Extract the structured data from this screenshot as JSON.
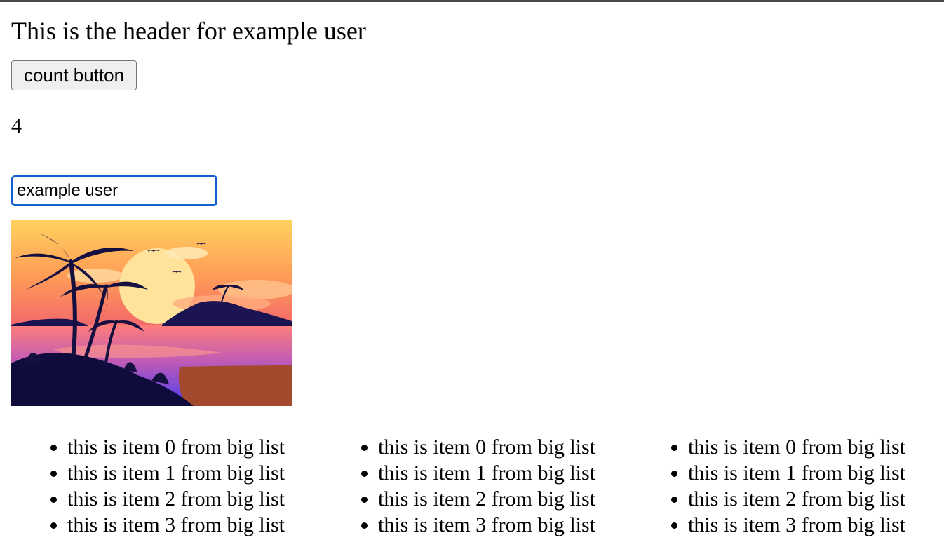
{
  "header": {
    "title": "This is the header for example user"
  },
  "counter": {
    "button_label": "count button",
    "value": "4"
  },
  "user_field": {
    "value": "example user"
  },
  "image": {
    "subject": "tropical sunset with palm tree silhouettes, island and sea"
  },
  "big_list": {
    "columns": [
      {
        "items": [
          "this is item 0 from big list",
          "this is item 1 from big list",
          "this is item 2 from big list",
          "this is item 3 from big list"
        ]
      },
      {
        "items": [
          "this is item 0 from big list",
          "this is item 1 from big list",
          "this is item 2 from big list",
          "this is item 3 from big list"
        ]
      },
      {
        "items": [
          "this is item 0 from big list",
          "this is item 1 from big list",
          "this is item 2 from big list",
          "this is item 3 from big list"
        ]
      }
    ]
  },
  "colors": {
    "input_focus_border": "#1160d1",
    "button_bg": "#efefef",
    "button_border": "#767676"
  }
}
